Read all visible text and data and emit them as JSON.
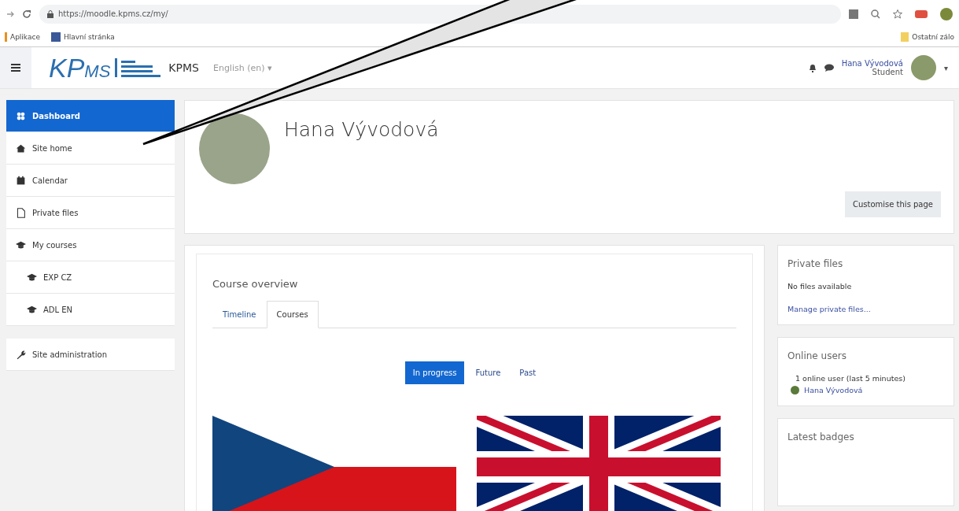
{
  "browser": {
    "address": "https://moodle.kpms.cz/my/",
    "bookmarks": [
      "Aplikace",
      "Hlavní stránka"
    ],
    "other_bookmarks": "Ostatní zálo"
  },
  "navbar": {
    "logo_main": "KP",
    "logo_sub": "MS",
    "site_name": "KPMS",
    "language": "English (en) ▾",
    "user_name": "Hana Vývodová",
    "user_role": "Student",
    "menu_caret": "▾"
  },
  "sidebar": {
    "items": [
      {
        "label": "Dashboard",
        "kind": "dashboard",
        "selected": true
      },
      {
        "label": "Site home",
        "kind": "home",
        "selected": false
      },
      {
        "label": "Calendar",
        "kind": "calendar",
        "selected": false
      },
      {
        "label": "Private files",
        "kind": "file",
        "selected": false
      },
      {
        "label": "My courses",
        "kind": "course",
        "selected": false,
        "children": [
          {
            "label": "EXP CZ",
            "kind": "course",
            "selected": false
          },
          {
            "label": "ADL EN",
            "kind": "course",
            "selected": false
          }
        ]
      }
    ],
    "admin": {
      "label": "Site administration",
      "kind": "admin",
      "selected": false
    }
  },
  "header": {
    "name": "Hana Vývodová",
    "customise_button": "Customise this page"
  },
  "course_overview": {
    "title": "Course overview",
    "tabs": [
      {
        "label": "Timeline",
        "selected": false
      },
      {
        "label": "Courses",
        "selected": true
      }
    ],
    "filters": [
      {
        "label": "In progress",
        "selected": true
      },
      {
        "label": "Future",
        "selected": false
      },
      {
        "label": "Past",
        "selected": false
      }
    ],
    "courses": [
      {
        "kind": "czech"
      },
      {
        "kind": "uk"
      }
    ]
  },
  "blocks": [
    {
      "kind": "files",
      "title": "Private files",
      "text": "No files available",
      "link": "Manage private files..."
    },
    {
      "kind": "users",
      "title": "Online users",
      "text": "1 online user (last 5 minutes)",
      "link": "Hana Vývodová"
    },
    {
      "kind": "badges",
      "title": "Latest badges"
    }
  ]
}
